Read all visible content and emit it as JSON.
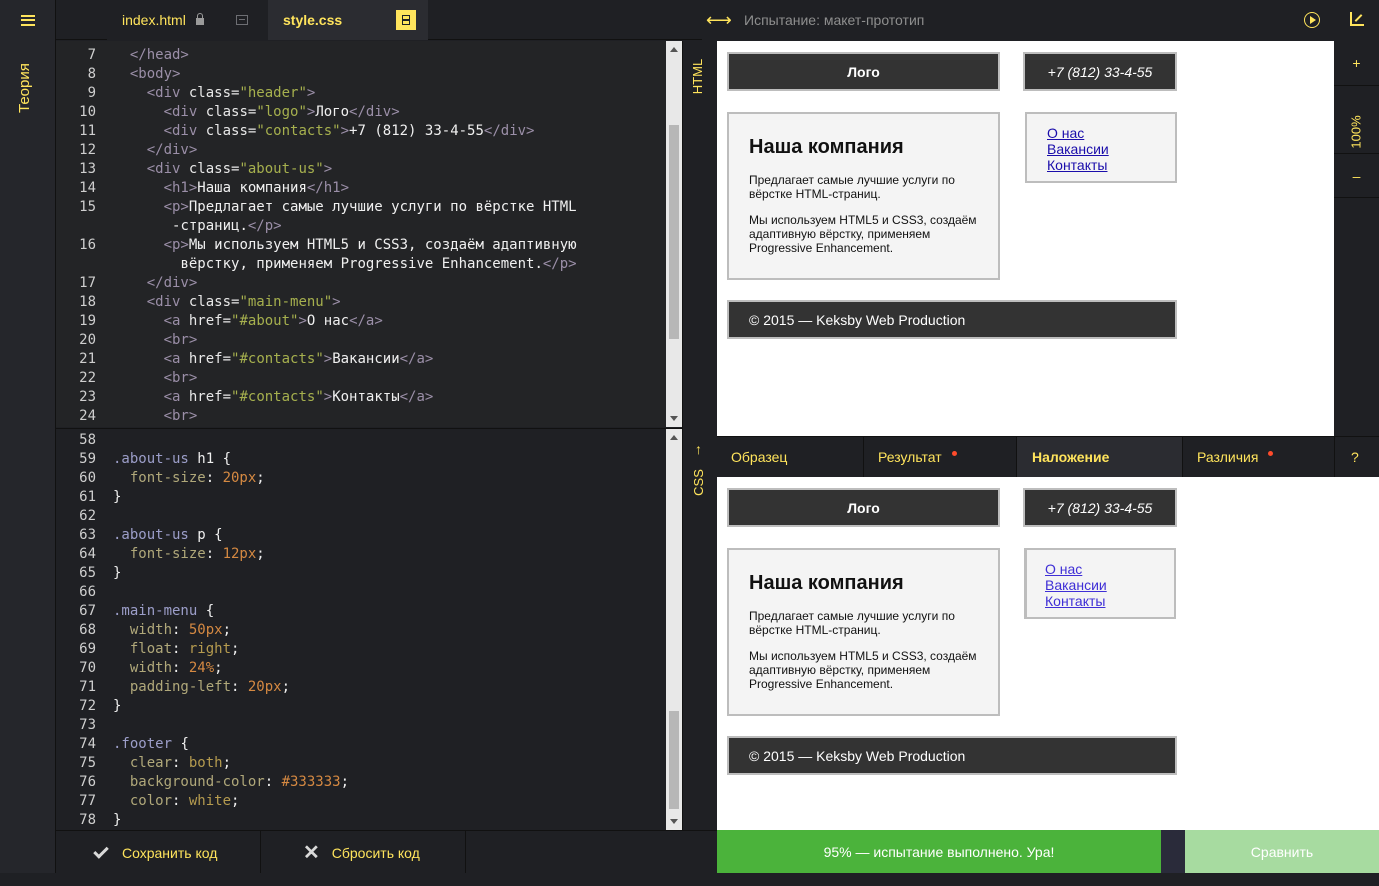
{
  "sidebar": {
    "theory_label": "Теория"
  },
  "tabs": [
    {
      "label": "index.html",
      "locked": true
    },
    {
      "label": "style.css",
      "active": true
    }
  ],
  "html_editor": {
    "lines": [
      {
        "n": "7",
        "html": "  <span class='tg'>&lt;/head&gt;</span>"
      },
      {
        "n": "8",
        "html": "  <span class='tg'>&lt;body&gt;</span>"
      },
      {
        "n": "9",
        "html": "    <span class='tg'>&lt;div</span> <span class='at'>class=</span><span class='st'>\"header\"</span><span class='tg'>&gt;</span>"
      },
      {
        "n": "10",
        "html": "      <span class='tg'>&lt;div</span> <span class='at'>class=</span><span class='st'>\"logo\"</span><span class='tg'>&gt;</span><span class='tx'>Лого</span><span class='tg'>&lt;/div&gt;</span>"
      },
      {
        "n": "11",
        "html": "      <span class='tg'>&lt;div</span> <span class='at'>class=</span><span class='st'>\"contacts\"</span><span class='tg'>&gt;</span><span class='tx'>+7 (812) 33-4-55</span><span class='tg'>&lt;/div&gt;</span>"
      },
      {
        "n": "12",
        "html": "    <span class='tg'>&lt;/div&gt;</span>"
      },
      {
        "n": "13",
        "html": "    <span class='tg'>&lt;div</span> <span class='at'>class=</span><span class='st'>\"about-us\"</span><span class='tg'>&gt;</span>"
      },
      {
        "n": "14",
        "html": "      <span class='tg'>&lt;h1&gt;</span><span class='tx'>Наша компания</span><span class='tg'>&lt;/h1&gt;</span>"
      },
      {
        "n": "15",
        "html": "      <span class='tg'>&lt;p&gt;</span><span class='tx'>Предлагает самые лучшие услуги по вёрстке HTML</span>"
      },
      {
        "n": "",
        "html": "       <span class='tx'>-страниц.</span><span class='tg'>&lt;/p&gt;</span>"
      },
      {
        "n": "16",
        "html": "      <span class='tg'>&lt;p&gt;</span><span class='tx'>Мы используем HTML5 и CSS3, создаём адаптивную</span>"
      },
      {
        "n": "",
        "html": "        <span class='tx'>вёрстку, применяем Progressive Enhancement.</span><span class='tg'>&lt;/p&gt;</span>"
      },
      {
        "n": "17",
        "html": "    <span class='tg'>&lt;/div&gt;</span>"
      },
      {
        "n": "18",
        "html": "    <span class='tg'>&lt;div</span> <span class='at'>class=</span><span class='st'>\"main-menu\"</span><span class='tg'>&gt;</span>"
      },
      {
        "n": "19",
        "html": "      <span class='tg'>&lt;a</span> <span class='at'>href=</span><span class='st'>\"#about\"</span><span class='tg'>&gt;</span><span class='tx'>О нас</span><span class='tg'>&lt;/a&gt;</span>"
      },
      {
        "n": "20",
        "html": "      <span class='tg'>&lt;br&gt;</span>"
      },
      {
        "n": "21",
        "html": "      <span class='tg'>&lt;a</span> <span class='at'>href=</span><span class='st'>\"#contacts\"</span><span class='tg'>&gt;</span><span class='tx'>Вакансии</span><span class='tg'>&lt;/a&gt;</span>"
      },
      {
        "n": "22",
        "html": "      <span class='tg'>&lt;br&gt;</span>"
      },
      {
        "n": "23",
        "html": "      <span class='tg'>&lt;a</span> <span class='at'>href=</span><span class='st'>\"#contacts\"</span><span class='tg'>&gt;</span><span class='tx'>Контакты</span><span class='tg'>&lt;/a&gt;</span>"
      },
      {
        "n": "24",
        "html": "      <span class='tg'>&lt;br&gt;</span>"
      }
    ]
  },
  "css_editor": {
    "lines": [
      {
        "n": "58",
        "html": ""
      },
      {
        "n": "59",
        "html": "<span class='sel'>.about-us</span> <span class='tx'>h1 {</span>"
      },
      {
        "n": "60",
        "html": "  <span class='pr'>font-size</span><span class='tx'>: </span><span class='nu'>20px</span><span class='tx'>;</span>"
      },
      {
        "n": "61",
        "html": "<span class='tx'>}</span>"
      },
      {
        "n": "62",
        "html": ""
      },
      {
        "n": "63",
        "html": "<span class='sel'>.about-us</span> <span class='tx'>p {</span>"
      },
      {
        "n": "64",
        "html": "  <span class='pr'>font-size</span><span class='tx'>: </span><span class='nu'>12px</span><span class='tx'>;</span>"
      },
      {
        "n": "65",
        "html": "<span class='tx'>}</span>"
      },
      {
        "n": "66",
        "html": ""
      },
      {
        "n": "67",
        "html": "<span class='sel'>.main-menu</span> <span class='tx'>{</span>"
      },
      {
        "n": "68",
        "html": "  <span class='pr'>width</span><span class='tx'>: </span><span class='nu'>50px</span><span class='tx'>;</span>"
      },
      {
        "n": "69",
        "html": "  <span class='pr'>float</span><span class='tx'>: </span><span class='kw'>right</span><span class='tx'>;</span>"
      },
      {
        "n": "70",
        "html": "  <span class='pr'>width</span><span class='tx'>: </span><span class='nu'>24%</span><span class='tx'>;</span>"
      },
      {
        "n": "71",
        "html": "  <span class='pr'>padding-left</span><span class='tx'>: </span><span class='nu'>20px</span><span class='tx'>;</span>"
      },
      {
        "n": "72",
        "html": "<span class='tx'>}</span>"
      },
      {
        "n": "73",
        "html": ""
      },
      {
        "n": "74",
        "html": "<span class='sel'>.footer</span> <span class='tx'>{</span>"
      },
      {
        "n": "75",
        "html": "  <span class='pr'>clear</span><span class='tx'>: </span><span class='kw'>both</span><span class='tx'>;</span>"
      },
      {
        "n": "76",
        "html": "  <span class='pr'>background-color</span><span class='tx'>: </span><span class='nu'>#333333</span><span class='tx'>;</span>"
      },
      {
        "n": "77",
        "html": "  <span class='pr'>color</span><span class='tx'>: </span><span class='kw'>white</span><span class='tx'>;</span>"
      },
      {
        "n": "78",
        "html": "<span class='tx'>}</span>"
      }
    ]
  },
  "panel_labels": {
    "html": "HTML",
    "css": "CSS"
  },
  "actions": {
    "save_label": "Сохранить код",
    "reset_label": "Сбросить код"
  },
  "preview": {
    "title": "Испытание: макет-прототип",
    "zoom_plus": "+",
    "zoom_value": "100%",
    "zoom_minus": "–"
  },
  "page": {
    "logo": "Лого",
    "contacts": "+7 (812) 33-4-55",
    "about_title": "Наша компания",
    "about_p1": "Предлагает самые лучшие услуги по вёрстке HTML-страниц.",
    "about_p2": "Мы используем HTML5 и CSS3, создаём адаптивную вёрстку, применяем Progressive Enhancement.",
    "menu": [
      "О нас",
      "Вакансии",
      "Контакты"
    ],
    "footer": "© 2015 — Keksby Web Production"
  },
  "modes": [
    {
      "label": "Образец",
      "dot": false
    },
    {
      "label": "Результат",
      "dot": true
    },
    {
      "label": "Наложение",
      "dot": false,
      "active": true
    },
    {
      "label": "Различия",
      "dot": true
    },
    {
      "label": "?",
      "dot": false
    }
  ],
  "result": {
    "text": "95% — испытание выполнено. Ура!",
    "compare_label": "Сравнить"
  },
  "colors": {
    "accent": "#ffe45c",
    "success": "#4bb33b",
    "compare": "#a7dba0",
    "dot": "#ff4b2b"
  }
}
